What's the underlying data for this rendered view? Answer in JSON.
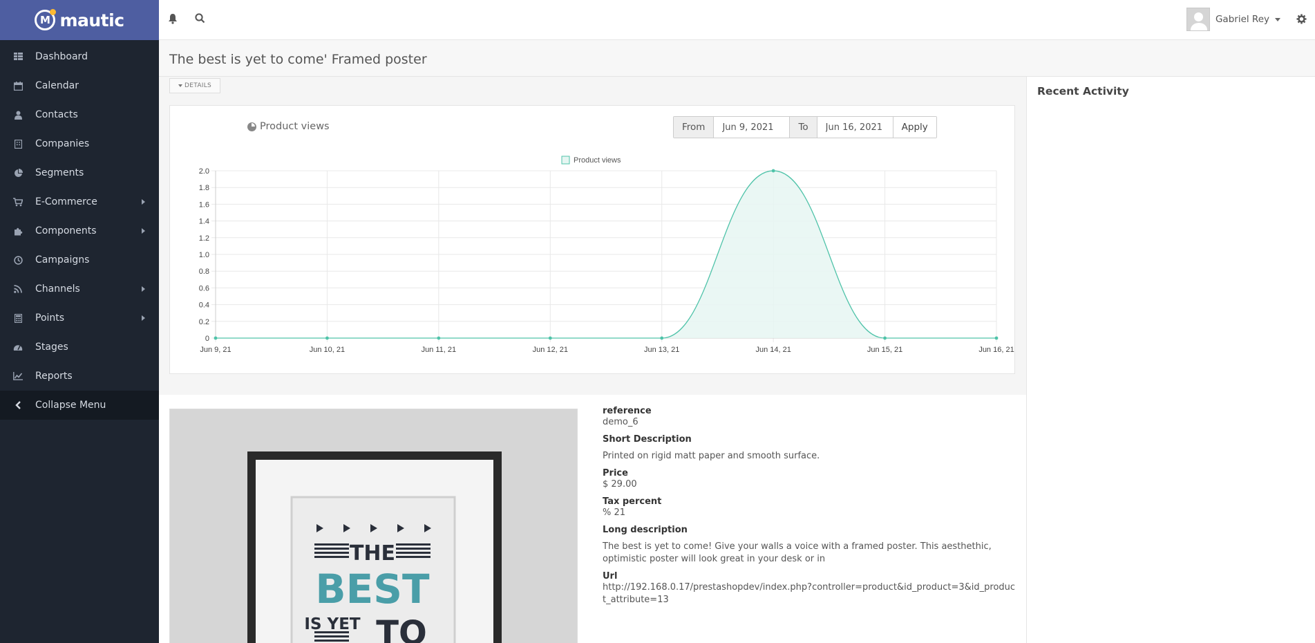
{
  "app": {
    "brand": "mautic"
  },
  "sidebar": {
    "items": [
      {
        "label": "Dashboard",
        "icon": "dashboard-icon",
        "has_submenu": false
      },
      {
        "label": "Calendar",
        "icon": "calendar-icon",
        "has_submenu": false
      },
      {
        "label": "Contacts",
        "icon": "user-icon",
        "has_submenu": false
      },
      {
        "label": "Companies",
        "icon": "building-icon",
        "has_submenu": false
      },
      {
        "label": "Segments",
        "icon": "pie-chart-icon",
        "has_submenu": false
      },
      {
        "label": "E-Commerce",
        "icon": "cart-icon",
        "has_submenu": true
      },
      {
        "label": "Components",
        "icon": "puzzle-icon",
        "has_submenu": true
      },
      {
        "label": "Campaigns",
        "icon": "clock-icon",
        "has_submenu": false
      },
      {
        "label": "Channels",
        "icon": "rss-icon",
        "has_submenu": true
      },
      {
        "label": "Points",
        "icon": "calculator-icon",
        "has_submenu": true
      },
      {
        "label": "Stages",
        "icon": "tachometer-icon",
        "has_submenu": false
      },
      {
        "label": "Reports",
        "icon": "line-chart-icon",
        "has_submenu": false
      }
    ],
    "collapse_label": "Collapse Menu"
  },
  "topbar": {
    "user_name": "Gabriel Rey"
  },
  "page": {
    "title": "The best is yet to come' Framed poster"
  },
  "details_button": "DETAILS",
  "chart_panel": {
    "title": "Product views",
    "from_label": "From",
    "from_value": "Jun 9, 2021",
    "to_label": "To",
    "to_value": "Jun 16, 2021",
    "apply_label": "Apply"
  },
  "chart_data": {
    "type": "area",
    "legend": "Product views",
    "categories": [
      "Jun 9, 21",
      "Jun 10, 21",
      "Jun 11, 21",
      "Jun 12, 21",
      "Jun 13, 21",
      "Jun 14, 21",
      "Jun 15, 21",
      "Jun 16, 21"
    ],
    "series": [
      {
        "name": "Product views",
        "values": [
          0,
          0,
          0,
          0,
          0,
          2,
          0,
          0
        ]
      }
    ],
    "yticks": [
      "0",
      "0.2",
      "0.4",
      "0.6",
      "0.8",
      "1.0",
      "1.2",
      "1.4",
      "1.6",
      "1.8",
      "2.0"
    ],
    "ylim": [
      0,
      2
    ],
    "colors": {
      "line": "#4fc3a9",
      "fill": "#e6f6f2"
    },
    "grid": true,
    "legend_position": "top"
  },
  "product": {
    "reference_label": "reference",
    "reference": "demo_6",
    "short_desc_label": "Short Description",
    "short_desc": "Printed on rigid matt paper and smooth surface.",
    "price_label": "Price",
    "price": "$ 29.00",
    "tax_label": "Tax percent",
    "tax": "% 21",
    "long_desc_label": "Long description",
    "long_desc": "The best is yet to come! Give your walls a voice with a framed poster. This aesthethic, optimistic poster will look great in your desk or in",
    "url_label": "Url",
    "url": "http://192.168.0.17/prestashopdev/index.php?controller=product&id_product=3&id_product_attribute=13",
    "poster_lines": [
      "THE",
      "BEST",
      "IS YET",
      "TO"
    ]
  },
  "right_panel": {
    "title": "Recent Activity"
  }
}
